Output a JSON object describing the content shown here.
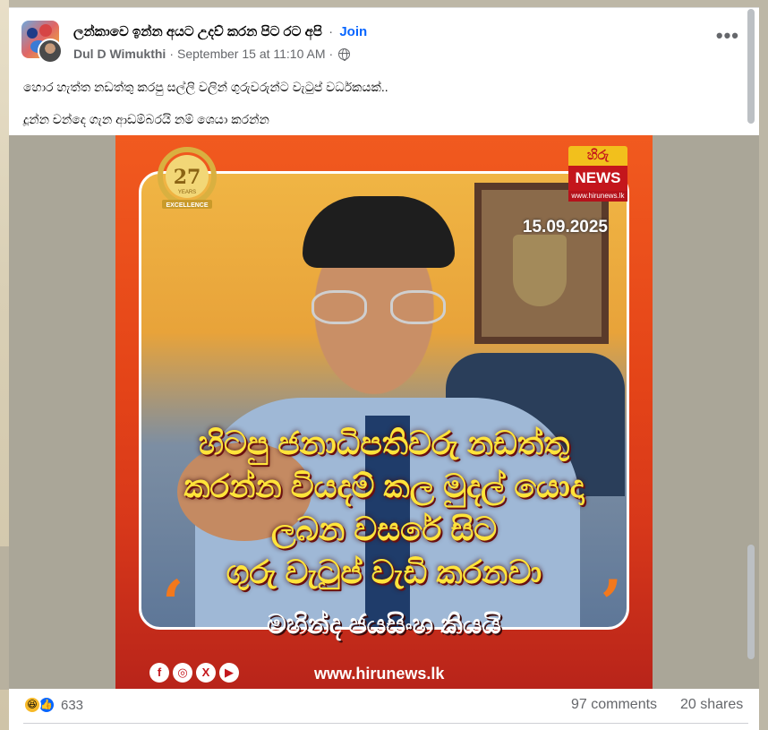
{
  "post": {
    "group_name": "ලන්කාවෙ ඉන්න අයට උදව් කරන පිට රට අපි",
    "separator": "·",
    "join_label": "Join",
    "author": "Dul D Wimukthi",
    "timestamp": "September 15 at 11:10 AM",
    "privacy_icon": "globe-icon",
    "more_icon": "more-options-icon",
    "text_line1": "හොර හැත්ත නඩත්තු කරපු සල්ලි වලින් ගුරුවරුන්ට වැටුප් වර්ධකයක්..",
    "text_line2": "දූන්න චන්දෙ ගැන ආඩම්බරයි නම් ශෙයා කරන්න"
  },
  "image": {
    "badge_number": "27",
    "badge_text1": "YEARS",
    "badge_text2": "EXCELLENCE",
    "logo_top": "හිරු",
    "logo_mid": "NEWS",
    "logo_bottom": "www.hirunews.lk",
    "date": "15.09.2025",
    "headline_line1": "හිටපු ජනාධිපතිවරු නඩත්තු",
    "headline_line2": "කරන්න වියදම් කල මුදල් යොදා",
    "headline_line3": "ලබන වසරේ සිට",
    "headline_line4": "ගුරු වැටුප් වැඩි කරනවා",
    "quote_open": "‘",
    "quote_close": "’",
    "speaker": "මහින්ද ජයසිංහ කියයි",
    "social_f": "f",
    "social_ig": "◎",
    "social_x": "X",
    "social_yt": "▶",
    "footer_url": "www.hirunews.lk"
  },
  "engagement": {
    "reaction_icons": [
      "haha-icon",
      "like-icon"
    ],
    "reaction_count": "633",
    "comments": "97 comments",
    "shares": "20 shares"
  },
  "colors": {
    "accent": "#0866ff",
    "headline": "#ffe43a",
    "quote": "#f3781c",
    "brand_red": "#c4161c"
  }
}
